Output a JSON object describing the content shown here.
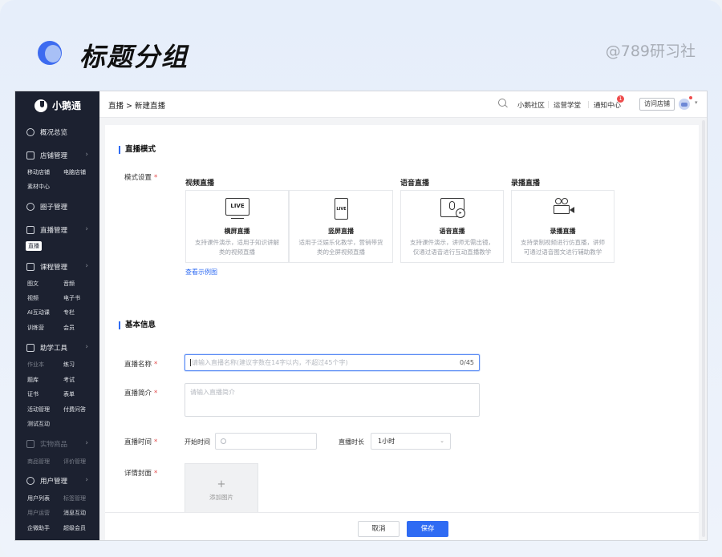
{
  "header": {
    "title": "标题分组",
    "brand": "@789研习社"
  },
  "sidebar": {
    "brand": "小鹅通",
    "groups": [
      {
        "label": "概况总览",
        "icon": "dashboard-icon"
      },
      {
        "label": "店铺管理",
        "icon": "store-icon"
      },
      {
        "label": "圈子管理",
        "icon": "community-icon"
      },
      {
        "label": "直播管理",
        "icon": "live-icon"
      },
      {
        "label": "课程管理",
        "icon": "course-icon"
      },
      {
        "label": "助学工具",
        "icon": "tools-icon"
      },
      {
        "label": "实物商品",
        "icon": "goods-icon"
      },
      {
        "label": "用户管理",
        "icon": "user-icon"
      }
    ],
    "store_items": [
      "移动店铺",
      "电脑店铺",
      "素材中心"
    ],
    "live_items": [
      "直播"
    ],
    "course_items": [
      "图文",
      "音频",
      "视频",
      "电子书",
      "AI互动课",
      "专栏",
      "训练营",
      "会员"
    ],
    "tool_items": [
      "作业本",
      "练习",
      "题库",
      "考试",
      "证书",
      "表单",
      "活动管理",
      "付费问答",
      "测试互动"
    ],
    "goods_items": [
      "商品管理",
      "评价管理"
    ],
    "user_items": [
      "用户列表",
      "标签管理",
      "用户运营",
      "消息互动",
      "企微助手",
      "超级会员"
    ]
  },
  "topbar": {
    "breadcrumb": "直播 > 新建直播",
    "links": [
      "小鹅社区",
      "运营学堂",
      "通知中心"
    ],
    "badge": "1",
    "visit_button": "访问店铺"
  },
  "mode_section": {
    "title": "直播模式",
    "field_label": "模式设置",
    "req": "*",
    "headers": [
      "视频直播",
      "语音直播",
      "录播直播"
    ],
    "cards": [
      {
        "title": "横屏直播",
        "desc": "支持课件演示，适用于知识讲解类的视频直播",
        "icon": "live-screen-icon",
        "icon_text": "LIVE"
      },
      {
        "title": "竖屏直播",
        "desc": "适用于泛娱乐化教学，营销带货类的全屏视频直播",
        "icon": "live-phone-icon",
        "icon_text": "LIVE"
      },
      {
        "title": "语音直播",
        "desc": "支持课件演示，讲师无需出镜，仅通过语音进行互动直播教学",
        "icon": "voice-live-icon"
      },
      {
        "title": "录播直播",
        "desc": "支持录制视频进行仿直播，讲师可通过语音图文进行辅助教学",
        "icon": "record-camera-icon"
      }
    ],
    "example_link": "查看示例图"
  },
  "basic_section": {
    "title": "基本信息",
    "name_label": "直播名称",
    "name_placeholder": "请输入直播名称(建议字数在14字以内，不超过45个字)",
    "name_count": "0/45",
    "intro_label": "直播简介",
    "intro_placeholder": "请输入直播简介",
    "time_label": "直播时间",
    "start_label": "开始时间",
    "duration_label": "直播时长",
    "duration_value": "1小时",
    "cover_label": "详情封面",
    "upload_plus": "+",
    "upload_label": "添加图片"
  },
  "footer": {
    "cancel": "取消",
    "save": "保存"
  }
}
